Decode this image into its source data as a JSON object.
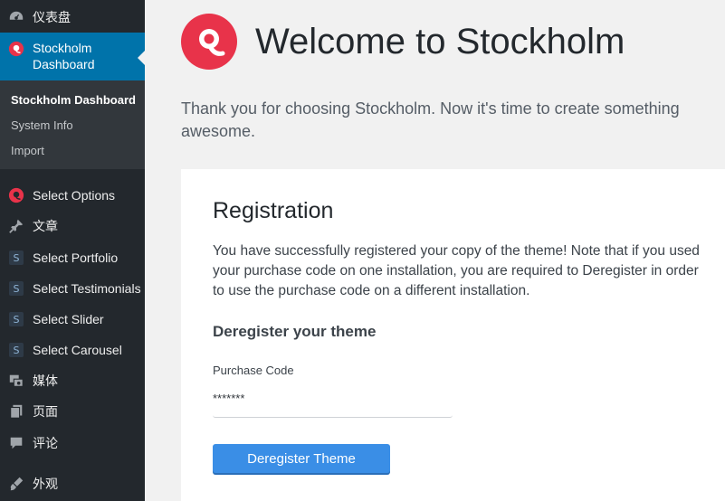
{
  "sidebar": {
    "dashboard_label": "仪表盘",
    "active_item_line1": "Stockholm",
    "active_item_line2": "Dashboard",
    "submenu": [
      {
        "label": "Stockholm Dashboard"
      },
      {
        "label": "System Info"
      },
      {
        "label": "Import"
      }
    ],
    "items": [
      {
        "label": "Select Options",
        "icon": "stockholm-logo-icon"
      },
      {
        "label": "文章",
        "icon": "pin-icon"
      },
      {
        "label": "Select Portfolio",
        "icon": "s-badge-icon",
        "badge": "S"
      },
      {
        "label": "Select Testimonials",
        "icon": "s-badge-icon",
        "badge": "S"
      },
      {
        "label": "Select Slider",
        "icon": "s-badge-icon",
        "badge": "S"
      },
      {
        "label": "Select Carousel",
        "icon": "s-badge-icon",
        "badge": "S"
      },
      {
        "label": "媒体",
        "icon": "media-icon"
      },
      {
        "label": "页面",
        "icon": "pages-icon"
      },
      {
        "label": "评论",
        "icon": "comments-icon"
      },
      {
        "label": "外观",
        "icon": "appearance-icon"
      }
    ]
  },
  "header": {
    "title": "Welcome to Stockholm",
    "about": "Thank you for choosing Stockholm. Now it's time to create something awesome."
  },
  "registration": {
    "title": "Registration",
    "text": "You have successfully registered your copy of the theme! Note that if you used your purchase code on one installation, you are required to Deregister in order to use the purchase code on a different installation.",
    "subtitle": "Deregister your theme",
    "field_label": "Purchase Code",
    "field_value": "*******",
    "button_label": "Deregister Theme"
  },
  "colors": {
    "sidebar_bg": "#23282d",
    "submenu_bg": "#32373c",
    "active_bg": "#0073aa",
    "brand_red": "#e8334a",
    "button_blue": "#3a8ee6"
  }
}
